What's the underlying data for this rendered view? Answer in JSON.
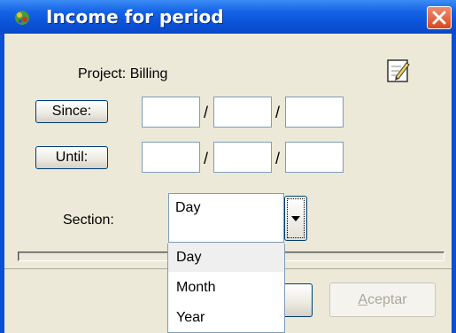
{
  "window": {
    "title": "Income for period",
    "icon": "app-icon",
    "close_icon": "close-icon"
  },
  "project": {
    "label": "Project: Billing",
    "edit_icon": "edit-notepad-icon"
  },
  "since": {
    "button_label": "Since:",
    "separator": "/"
  },
  "until": {
    "button_label": "Until:",
    "separator": "/"
  },
  "section": {
    "label": "Section:",
    "value": "Day",
    "options": [
      "Day",
      "Month",
      "Year"
    ],
    "selected_index": 0
  },
  "buttons": {
    "accept_label": "Aceptar",
    "accept_enabled": false
  },
  "colors": {
    "titlebar": "#0a50d6",
    "client": "#ece9d8",
    "close": "#d9471d"
  }
}
